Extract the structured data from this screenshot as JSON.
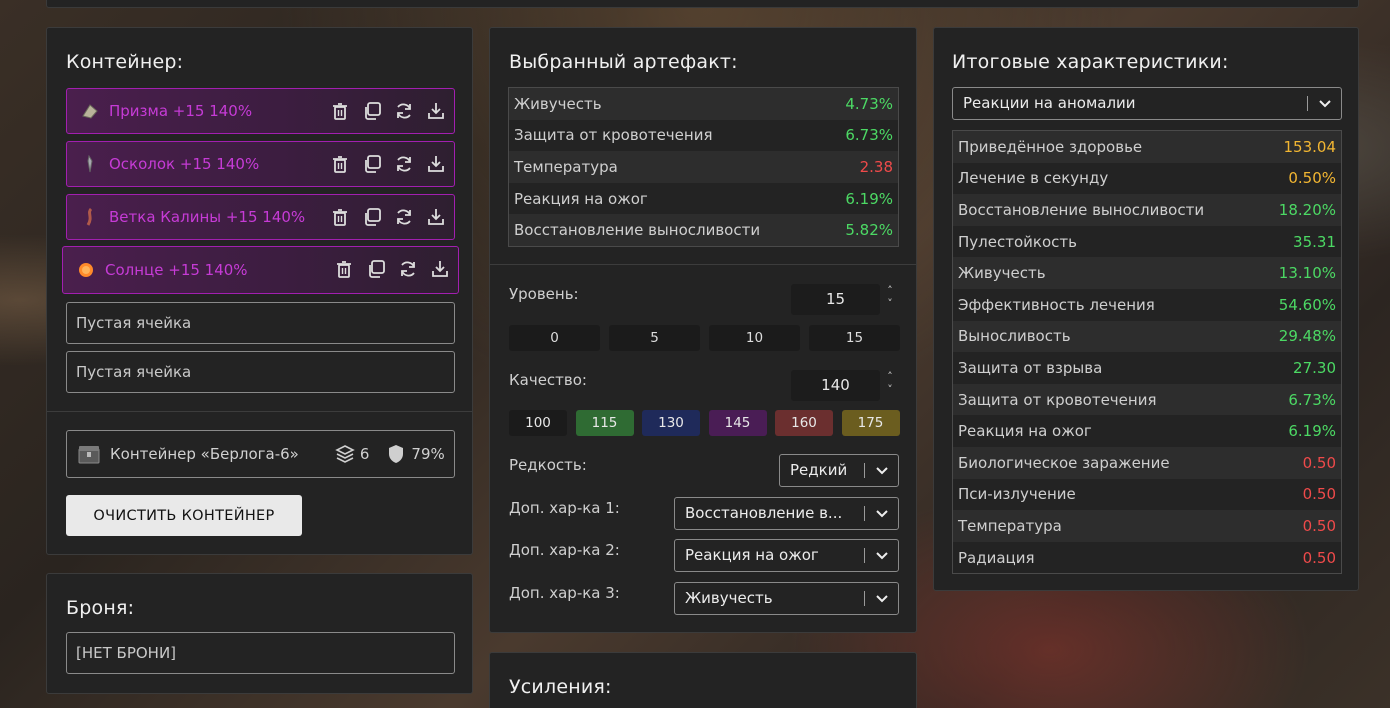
{
  "container": {
    "title": "Контейнер:",
    "slots": [
      {
        "label": "Призма +15 140%",
        "icon": "prism-artifact-icon"
      },
      {
        "label": "Осколок +15 140%",
        "icon": "shard-artifact-icon"
      },
      {
        "label": "Ветка Калины +15 140%",
        "icon": "viburnum-branch-icon"
      },
      {
        "label": "Солнце +15 140%",
        "icon": "sun-artifact-icon"
      }
    ],
    "empty_cells": [
      "Пустая ячейка",
      "Пустая ячейка"
    ],
    "info": {
      "name": "Контейнер «Берлога-6»",
      "slots": "6",
      "protection": "79%"
    },
    "clear_button": "ОЧИСТИТЬ КОНТЕЙНЕР"
  },
  "armor": {
    "title": "Броня:",
    "value": "[НЕТ БРОНИ]"
  },
  "artifact": {
    "title": "Выбранный артефакт:",
    "stats": [
      {
        "name": "Живучесть",
        "value": "4.73%",
        "tone": "green"
      },
      {
        "name": "Защита от кровотечения",
        "value": "6.73%",
        "tone": "green"
      },
      {
        "name": "Температура",
        "value": "2.38",
        "tone": "red"
      },
      {
        "name": "Реакция на ожог",
        "value": "6.19%",
        "tone": "green"
      },
      {
        "name": "Восстановление выносливости",
        "value": "5.82%",
        "tone": "green"
      }
    ],
    "level_label": "Уровень:",
    "level_value": "15",
    "level_presets": [
      "0",
      "5",
      "10",
      "15"
    ],
    "quality_label": "Качество:",
    "quality_value": "140",
    "quality_presets": [
      {
        "label": "100",
        "color": "#1b1b1b"
      },
      {
        "label": "115",
        "color": "#2f6b33"
      },
      {
        "label": "130",
        "color": "#1f2a5a"
      },
      {
        "label": "145",
        "color": "#4a1d55"
      },
      {
        "label": "160",
        "color": "#6b2f2f"
      },
      {
        "label": "175",
        "color": "#6b5d1f"
      }
    ],
    "rarity_label": "Редкость:",
    "rarity_value": "Редкий",
    "extra1_label": "Доп. хар-ка 1:",
    "extra1_value": "Восстановление в...",
    "extra2_label": "Доп. хар-ка 2:",
    "extra2_value": "Реакция на ожог",
    "extra3_label": "Доп. хар-ка 3:",
    "extra3_value": "Живучесть"
  },
  "totals": {
    "title": "Итоговые характеристики:",
    "filter_value": "Реакции на аномалии",
    "stats": [
      {
        "name": "Приведённое здоровье",
        "value": "153.04",
        "tone": "yellow"
      },
      {
        "name": "Лечение в секунду",
        "value": "0.50%",
        "tone": "yellow"
      },
      {
        "name": "Восстановление выносливости",
        "value": "18.20%",
        "tone": "green"
      },
      {
        "name": "Пулестойкость",
        "value": "35.31",
        "tone": "green"
      },
      {
        "name": "Живучесть",
        "value": "13.10%",
        "tone": "green"
      },
      {
        "name": "Эффективность лечения",
        "value": "54.60%",
        "tone": "green"
      },
      {
        "name": "Выносливость",
        "value": "29.48%",
        "tone": "green"
      },
      {
        "name": "Защита от взрыва",
        "value": "27.30",
        "tone": "green"
      },
      {
        "name": "Защита от кровотечения",
        "value": "6.73%",
        "tone": "green"
      },
      {
        "name": "Реакция на ожог",
        "value": "6.19%",
        "tone": "green"
      },
      {
        "name": "Биологическое заражение",
        "value": "0.50",
        "tone": "red"
      },
      {
        "name": "Пси-излучение",
        "value": "0.50",
        "tone": "red"
      },
      {
        "name": "Температура",
        "value": "0.50",
        "tone": "red"
      },
      {
        "name": "Радиация",
        "value": "0.50",
        "tone": "red"
      }
    ]
  },
  "boosts": {
    "title": "Усиления:"
  }
}
